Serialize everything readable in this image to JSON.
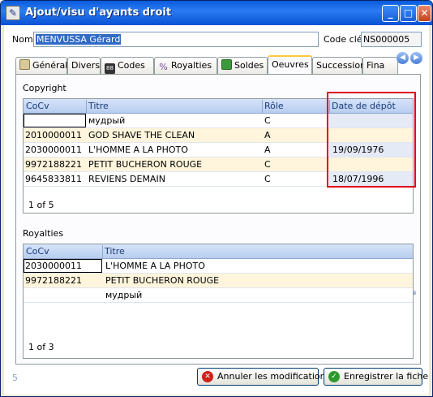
{
  "window": {
    "title": "Ajout/visu d'ayants droit"
  },
  "header": {
    "nom_label": "Nom",
    "nom_value": "MENVUSSA Gérard",
    "code_label": "Code clé",
    "code_value": "NS000005"
  },
  "tabs": [
    {
      "label": "Général",
      "active": false
    },
    {
      "label": "Divers",
      "active": false
    },
    {
      "label": "Codes",
      "active": false
    },
    {
      "label": "Royalties",
      "active": false
    },
    {
      "label": "Soldes",
      "active": false
    },
    {
      "label": "Oeuvres",
      "active": true
    },
    {
      "label": "Succession",
      "active": false
    },
    {
      "label": "Fina",
      "active": false
    }
  ],
  "copyright": {
    "section_label": "Copyright",
    "columns": [
      "CoCv",
      "Titre",
      "Rôle",
      "Date de dépôt"
    ],
    "rows": [
      {
        "cocv": "",
        "titre": "мудрый",
        "role": "C",
        "date": ""
      },
      {
        "cocv": "2010000011",
        "titre": "GOD SHAVE THE CLEAN",
        "role": "A",
        "date": ""
      },
      {
        "cocv": "2030000011",
        "titre": "L'HOMME A LA PHOTO",
        "role": "A",
        "date": "19/09/1976"
      },
      {
        "cocv": "9972188221",
        "titre": "PETIT BUCHERON ROUGE",
        "role": "C",
        "date": ""
      },
      {
        "cocv": "9645833811",
        "titre": "REVIENS DEMAIN",
        "role": "C",
        "date": "18/07/1996"
      }
    ],
    "pager": "1 of 5"
  },
  "royalties": {
    "section_label": "Royalties",
    "columns": [
      "CoCv",
      "Titre"
    ],
    "rows": [
      {
        "cocv": "2030000011",
        "titre": "L'HOMME A LA PHOTO"
      },
      {
        "cocv": "9972188221",
        "titre": "PETIT BUCHERON ROUGE"
      },
      {
        "cocv": "",
        "titre": "мудрый"
      }
    ],
    "pager": "1 of 3"
  },
  "footer": {
    "number": "5",
    "cancel_label": "Annuler les modifications",
    "save_label": "Enregistrer la fiche"
  },
  "colors": {
    "title_bar": "#0a5cdd",
    "highlight_border": "#e0001a",
    "alt_row": "#fff5dc"
  }
}
